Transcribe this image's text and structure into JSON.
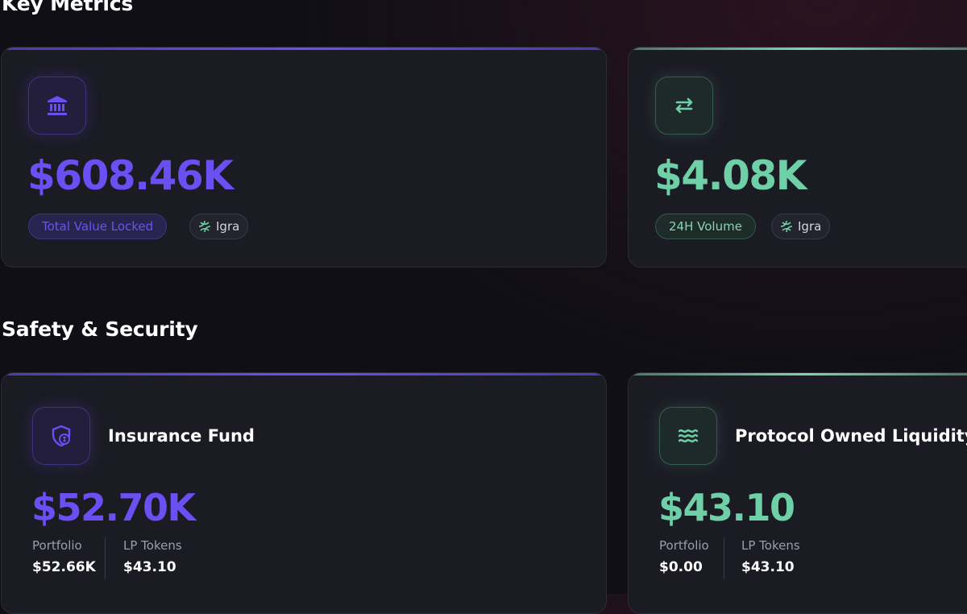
{
  "sections": {
    "key_metrics_title": "Key Metrics",
    "safety_title": "Safety & Security"
  },
  "key_metrics": {
    "tvl": {
      "value": "$608.46K",
      "label": "Total Value Locked",
      "network": "Igra",
      "icon": "bank-icon",
      "accent": "#6a4ff2"
    },
    "volume": {
      "value": "$4.08K",
      "label": "24H Volume",
      "network": "Igra",
      "icon": "swap-arrows-icon",
      "accent": "#6fcfa6"
    }
  },
  "safety": {
    "insurance": {
      "title": "Insurance Fund",
      "value": "$52.70K",
      "icon": "shield-dollar-icon",
      "stats": [
        {
          "label": "Portfolio",
          "value": "$52.66K"
        },
        {
          "label": "LP Tokens",
          "value": "$43.10"
        }
      ]
    },
    "pol": {
      "title": "Protocol Owned Liquidity",
      "value": "$43.10",
      "icon": "waves-icon",
      "stats": [
        {
          "label": "Portfolio",
          "value": "$0.00"
        },
        {
          "label": "LP Tokens",
          "value": "$43.10"
        }
      ]
    }
  }
}
